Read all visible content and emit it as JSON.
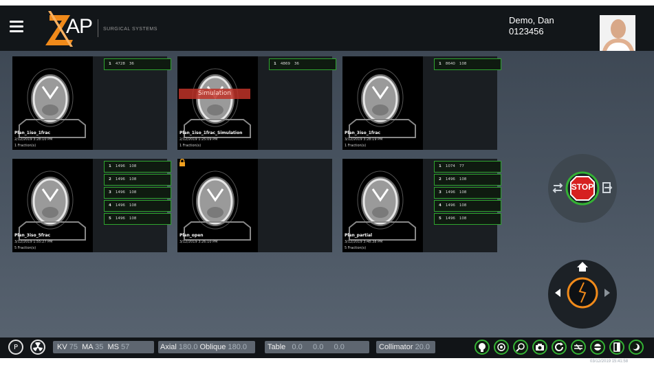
{
  "header": {
    "logo_text": "AP",
    "logo_subtitle": "SURGICAL SYSTEMS",
    "user_name": "Demo,   Dan",
    "user_id": "0123456"
  },
  "plans": [
    {
      "name": "Plan_1iso_1frac",
      "date": "2/12/2019 3:28:10 PM",
      "fractions_label": "1 Fraction(s)",
      "locked": false,
      "banner": "",
      "fractions": [
        {
          "n": "1",
          "a": "4728",
          "b": "36"
        }
      ]
    },
    {
      "name": "Plan_1iso_1frac_Simulation",
      "date": "2/12/2019 1:25:09 PM",
      "fractions_label": "1 Fraction(s)",
      "locked": false,
      "banner": "Simulation",
      "fractions": [
        {
          "n": "1",
          "a": "4869",
          "b": "36"
        }
      ]
    },
    {
      "name": "Plan_3iso_1frac",
      "date": "3/12/2019 3:28:19 PM",
      "fractions_label": "1 Fraction(s)",
      "locked": false,
      "banner": "",
      "fractions": [
        {
          "n": "1",
          "a": "8640",
          "b": "108"
        }
      ]
    },
    {
      "name": "Plan_3iso_5frac",
      "date": "3/12/2019 1:55:27 PM",
      "fractions_label": "5 Fraction(s)",
      "locked": false,
      "banner": "",
      "fractions": [
        {
          "n": "1",
          "a": "1496",
          "b": "108"
        },
        {
          "n": "2",
          "a": "1496",
          "b": "108"
        },
        {
          "n": "3",
          "a": "1496",
          "b": "108"
        },
        {
          "n": "4",
          "a": "1496",
          "b": "108"
        },
        {
          "n": "5",
          "a": "1496",
          "b": "108"
        }
      ]
    },
    {
      "name": "Plan_open",
      "date": "3/12/2019 3:26:10 PM",
      "fractions_label": "",
      "locked": true,
      "banner": "",
      "fractions": []
    },
    {
      "name": "Plan_partial",
      "date": "3/12/2019 3:48:38 PM",
      "fractions_label": "5 Fraction(s)",
      "locked": false,
      "banner": "",
      "fractions": [
        {
          "n": "1",
          "a": "1074",
          "b": "77"
        },
        {
          "n": "2",
          "a": "1496",
          "b": "108"
        },
        {
          "n": "3",
          "a": "1496",
          "b": "108"
        },
        {
          "n": "4",
          "a": "1496",
          "b": "108"
        },
        {
          "n": "5",
          "a": "1496",
          "b": "108"
        }
      ]
    }
  ],
  "controls": {
    "stop_label": "STOP"
  },
  "statusbar": {
    "p_label": "P",
    "kv_label": "KV",
    "kv_value": "75",
    "ma_label": "MA",
    "ma_value": "35",
    "ms_label": "MS",
    "ms_value": "57",
    "axial_label": "Axial",
    "axial_value": "180.0",
    "oblique_label": "Oblique",
    "oblique_value": "180.0",
    "table_label": "Table",
    "table_v1": "0.0",
    "table_v2": "0.0",
    "table_v3": "0.0",
    "collimator_label": "Collimator",
    "collimator_value": "20.0",
    "datetime": "03/12/2019 15:41:58"
  },
  "colors": {
    "accent_green": "#34b234",
    "stop_red": "#d62020",
    "orange": "#f08a1a"
  }
}
